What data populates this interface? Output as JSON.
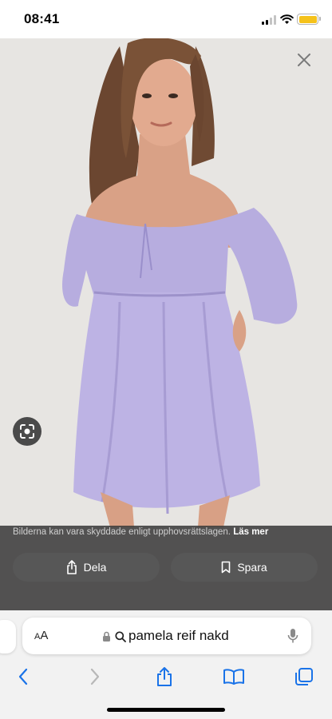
{
  "status_bar": {
    "time": "08:41"
  },
  "viewer": {
    "copyright_text": "Bilderna kan vara skyddade enligt upphovsrättslagen. ",
    "learn_more": "Läs mer",
    "share_label": "Dela",
    "save_label": "Spara"
  },
  "address_bar": {
    "aa_label": "AA",
    "url": "pamela reif nakd"
  },
  "colors": {
    "accent": "#1a73e8",
    "battery": "#f5c21b",
    "dress": "#b8aee0"
  }
}
